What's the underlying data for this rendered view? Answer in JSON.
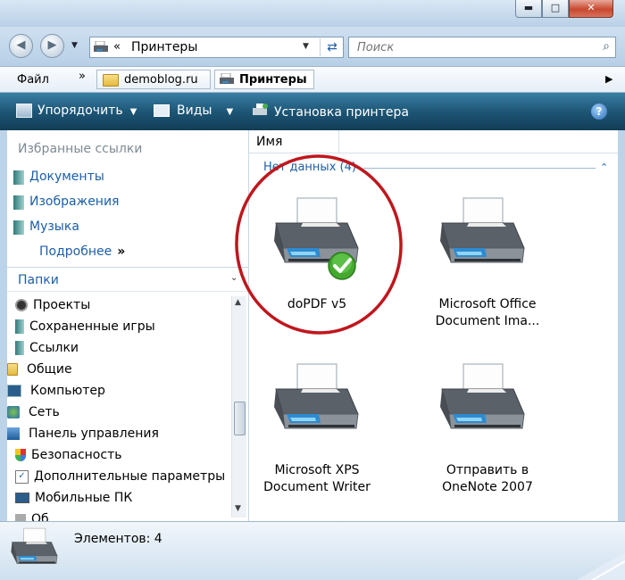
{
  "window": {
    "minimize": "▬",
    "maximize": "□",
    "close": "✕"
  },
  "address": {
    "prefix": "«",
    "path": "Принтеры"
  },
  "search": {
    "placeholder": "Поиск"
  },
  "menubar": {
    "file": "Файл",
    "chevron": "»",
    "tabs": [
      {
        "label": "demoblog.ru"
      },
      {
        "label": "Принтеры"
      }
    ],
    "arrow": "▶"
  },
  "toolbar": {
    "organize": "Упорядочить",
    "views": "Виды",
    "install_printer": "Установка принтера",
    "help": "?"
  },
  "sidebar": {
    "favorites_header": "Избранные ссылки",
    "favorites": [
      {
        "label": "Документы"
      },
      {
        "label": "Изображения"
      },
      {
        "label": "Музыка"
      }
    ],
    "more": "Подробнее",
    "more_chevron": "»",
    "folders_header": "Папки",
    "tree": [
      {
        "label": "Проекты"
      },
      {
        "label": "Сохраненные игры"
      },
      {
        "label": "Ссылки"
      },
      {
        "label": "Общие"
      },
      {
        "label": "Компьютер"
      },
      {
        "label": "Сеть"
      },
      {
        "label": "Панель управления"
      },
      {
        "label": "Безопасность"
      },
      {
        "label": "Дополнительные параметры"
      },
      {
        "label": "Мобильные ПК"
      },
      {
        "label": "Об"
      }
    ]
  },
  "content": {
    "column_name": "Имя",
    "group_label": "Нет данных (4)",
    "items": [
      {
        "line1": "doPDF v5",
        "line2": "",
        "default": true
      },
      {
        "line1": "Microsoft Office",
        "line2": "Document Ima...",
        "default": false
      },
      {
        "line1": "Microsoft XPS",
        "line2": "Document Writer",
        "default": false
      },
      {
        "line1": "Отправить в",
        "line2": "OneNote 2007",
        "default": false
      }
    ]
  },
  "status": {
    "count_text": "Элементов: 4"
  },
  "colors": {
    "highlight_circle": "#c0161d",
    "toolbar": "#1d5676",
    "link": "#1d5fa8"
  }
}
